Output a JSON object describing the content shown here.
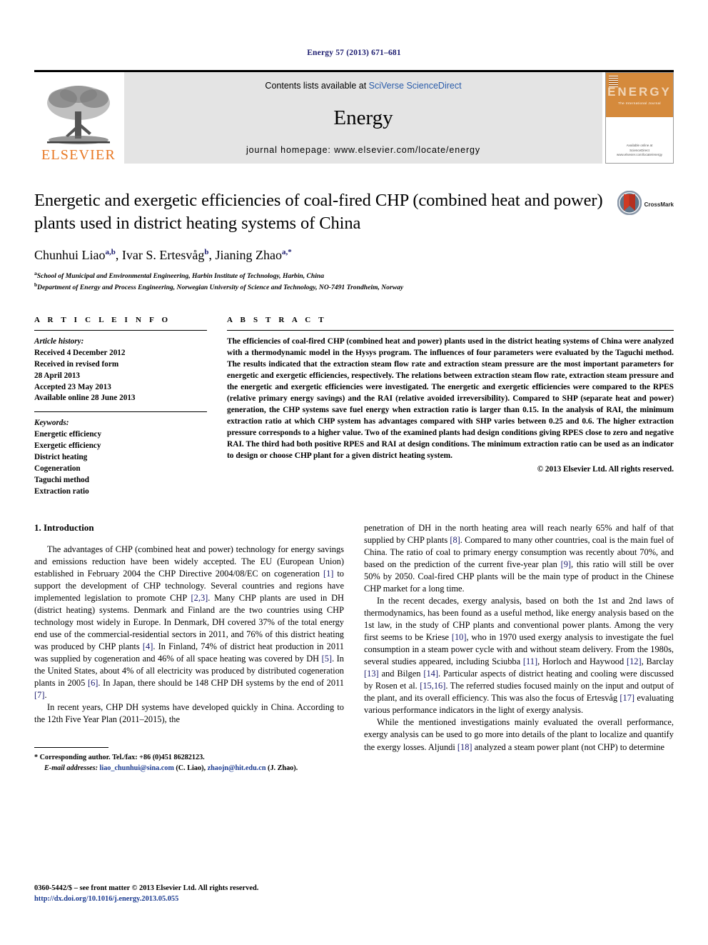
{
  "running_head": "Energy 57 (2013) 671–681",
  "masthead": {
    "publisher_name": "ELSEVIER",
    "publisher_logo_icon": "elsevier-tree-icon",
    "contents_prefix": "Contents lists available at ",
    "contents_link": "SciVerse ScienceDirect",
    "journal_title": "Energy",
    "homepage": "journal homepage: www.elsevier.com/locate/energy",
    "cover": {
      "wordmark": "ENERGY",
      "subtitle": "The International Journal",
      "footer_line1": "Available online at",
      "footer_line2": "ScienceDirect",
      "footer_line3": "www.elsevier.com/locate/energy"
    }
  },
  "article": {
    "title": "Energetic and exergetic efficiencies of coal-fired CHP (combined heat and power) plants used in district heating systems of China",
    "crossmark_label": "CrossMark",
    "crossmark_icon": "crossmark-icon",
    "authors_html": "Chunhui Liao<sup>a,b</sup>, Ivar S. Ertesvåg<sup>b</sup>, Jianing Zhao<sup>a,*</sup>",
    "affiliations": [
      {
        "marker": "a",
        "text": "School of Municipal and Environmental Engineering, Harbin Institute of Technology, Harbin, China"
      },
      {
        "marker": "b",
        "text": "Department of Energy and Process Engineering, Norwegian University of Science and Technology, NO-7491 Trondheim, Norway"
      }
    ]
  },
  "article_info": {
    "heading": "A R T I C L E   I N F O",
    "history_label": "Article history:",
    "history": [
      "Received 4 December 2012",
      "Received in revised form",
      "28 April 2013",
      "Accepted 23 May 2013",
      "Available online 28 June 2013"
    ],
    "keywords_label": "Keywords:",
    "keywords": [
      "Energetic efficiency",
      "Exergetic efficiency",
      "District heating",
      "Cogeneration",
      "Taguchi method",
      "Extraction ratio"
    ]
  },
  "abstract": {
    "heading": "A B S T R A C T",
    "text": "The efficiencies of coal-fired CHP (combined heat and power) plants used in the district heating systems of China were analyzed with a thermodynamic model in the Hysys program. The influences of four parameters were evaluated by the Taguchi method. The results indicated that the extraction steam flow rate and extraction steam pressure are the most important parameters for energetic and exergetic efficiencies, respectively. The relations between extraction steam flow rate, extraction steam pressure and the energetic and exergetic efficiencies were investigated. The energetic and exergetic efficiencies were compared to the RPES (relative primary energy savings) and the RAI (relative avoided irreversibility). Compared to SHP (separate heat and power) generation, the CHP systems save fuel energy when extraction ratio is larger than 0.15. In the analysis of RAI, the minimum extraction ratio at which CHP system has advantages compared with SHP varies between 0.25 and 0.6. The higher extraction pressure corresponds to a higher value. Two of the examined plants had design conditions giving RPES close to zero and negative RAI. The third had both positive RPES and RAI at design conditions. The minimum extraction ratio can be used as an indicator to design or choose CHP plant for a given district heating system.",
    "copyright": "© 2013 Elsevier Ltd. All rights reserved."
  },
  "introduction": {
    "heading": "1.  Introduction",
    "left_paragraphs": [
      "The advantages of CHP (combined heat and power) technology for energy savings and emissions reduction have been widely accepted. The EU (European Union) established in February 2004 the CHP Directive 2004/08/EC on cogeneration [1] to support the development of CHP technology. Several countries and regions have implemented legislation to promote CHP [2,3]. Many CHP plants are used in DH (district heating) systems. Denmark and Finland are the two countries using CHP technology most widely in Europe. In Denmark, DH covered 37% of the total energy end use of the commercial-residential sectors in 2011, and 76% of this district heating was produced by CHP plants [4]. In Finland, 74% of district heat production in 2011 was supplied by cogeneration and 46% of all space heating was covered by DH [5]. In the United States, about 4% of all electricity was produced by distributed cogeneration plants in 2005 [6]. In Japan, there should be 148 CHP DH systems by the end of 2011 [7].",
      "In recent years, CHP DH systems have developed quickly in China. According to the 12th Five Year Plan (2011–2015), the"
    ],
    "right_paragraphs": [
      "penetration of DH in the north heating area will reach nearly 65% and half of that supplied by CHP plants [8]. Compared to many other countries, coal is the main fuel of China. The ratio of coal to primary energy consumption was recently about 70%, and based on the prediction of the current five-year plan [9], this ratio will still be over 50% by 2050. Coal-fired CHP plants will be the main type of product in the Chinese CHP market for a long time.",
      "In the recent decades, exergy analysis, based on both the 1st and 2nd laws of thermodynamics, has been found as a useful method, like energy analysis based on the 1st law, in the study of CHP plants and conventional power plants. Among the very first seems to be Kriese [10], who in 1970 used exergy analysis to investigate the fuel consumption in a steam power cycle with and without steam delivery. From the 1980s, several studies appeared, including Sciubba [11], Horloch and Haywood [12], Barclay [13] and Bilgen [14]. Particular aspects of district heating and cooling were discussed by Rosen et al. [15,16]. The referred studies focused mainly on the input and output of the plant, and its overall efficiency. This was also the focus of Ertesvåg [17] evaluating various performance indicators in the light of exergy analysis.",
      "While the mentioned investigations mainly evaluated the overall performance, exergy analysis can be used to go more into details of the plant to localize and quantify the exergy losses. Aljundi [18] analyzed a steam power plant (not CHP) to determine"
    ]
  },
  "footnote": {
    "corresponding": "* Corresponding author. Tel./fax: +86 (0)451 86282123.",
    "email_label": "E-mail addresses:",
    "email1": "liao_chunhui@sina.com",
    "email1_who": " (C. Liao), ",
    "email2": "zhaojn@hit.edu.cn",
    "email2_who": " (J. Zhao)."
  },
  "page_footer": {
    "issn_line": "0360-5442/$ – see front matter © 2013 Elsevier Ltd. All rights reserved.",
    "doi": "http://dx.doi.org/10.1016/j.energy.2013.05.055"
  }
}
